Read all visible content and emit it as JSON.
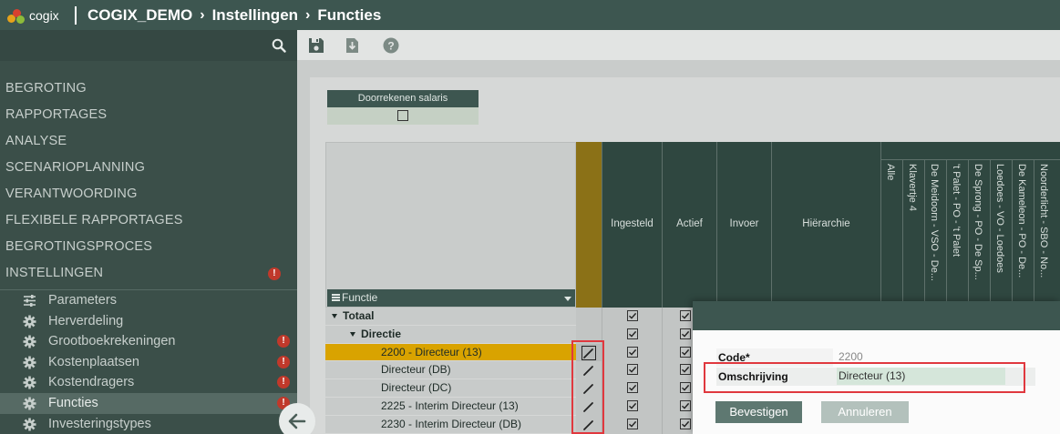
{
  "header": {
    "logo_text": "cogix",
    "crumbs": [
      "COGIX_DEMO",
      "Instellingen",
      "Functies"
    ],
    "crumb_separator": "›"
  },
  "sidebar": {
    "search_icon": "search-icon",
    "main_items": [
      {
        "label": "BEGROTING",
        "alert": false
      },
      {
        "label": "RAPPORTAGES",
        "alert": false
      },
      {
        "label": "ANALYSE",
        "alert": false
      },
      {
        "label": "SCENARIOPLANNING",
        "alert": false
      },
      {
        "label": "VERANTWOORDING",
        "alert": false
      },
      {
        "label": "FLEXIBELE RAPPORTAGES",
        "alert": false
      },
      {
        "label": "BEGROTINGSPROCES",
        "alert": false
      },
      {
        "label": "INSTELLINGEN",
        "alert": true
      }
    ],
    "sub_items": [
      {
        "label": "Parameters",
        "icon": "sliders-icon",
        "alert": false,
        "active": false
      },
      {
        "label": "Herverdeling",
        "icon": "gear-icon",
        "alert": false,
        "active": false
      },
      {
        "label": "Grootboekrekeningen",
        "icon": "gear-icon",
        "alert": true,
        "active": false
      },
      {
        "label": "Kostenplaatsen",
        "icon": "gear-icon",
        "alert": true,
        "active": false
      },
      {
        "label": "Kostendragers",
        "icon": "gear-icon",
        "alert": true,
        "active": false
      },
      {
        "label": "Functies",
        "icon": "gear-icon",
        "alert": true,
        "active": true
      },
      {
        "label": "Investeringstypes",
        "icon": "gear-icon",
        "alert": false,
        "active": false
      }
    ],
    "alert_glyph": "!"
  },
  "toolbar": {
    "icons": [
      "save-icon",
      "download-icon",
      "help-icon"
    ]
  },
  "recalc": {
    "label": "Doorrekenen salaris",
    "checked": false
  },
  "grid": {
    "first_column_label": "Functie",
    "columns": [
      "Ingesteld",
      "Actief",
      "Invoer",
      "Hiërarchie"
    ],
    "vertical_columns": [
      "Alle",
      "Klavertje 4",
      "De Meidoorn - VSO - De...",
      "'t Palet - PO - 't Palet",
      "De Sprong - PO - De Sp...",
      "Loedoes - VO - Loedoes",
      "De Kameleon - PO - De...",
      "Noorderlicht - SBO - No..."
    ],
    "rows": [
      {
        "label": "Totaal",
        "level": 0,
        "expandable": true,
        "selected": false,
        "editable": false
      },
      {
        "label": "Directie",
        "level": 1,
        "expandable": true,
        "selected": false,
        "editable": false
      },
      {
        "label": "2200 - Directeur (13)",
        "level": 2,
        "expandable": false,
        "selected": true,
        "editable": true
      },
      {
        "label": "Directeur (DB)",
        "level": 2,
        "expandable": false,
        "selected": false,
        "editable": true
      },
      {
        "label": "Directeur (DC)",
        "level": 2,
        "expandable": false,
        "selected": false,
        "editable": true
      },
      {
        "label": "2225 - Interim Directeur (13)",
        "level": 2,
        "expandable": false,
        "selected": false,
        "editable": true
      },
      {
        "label": "2230 - Interim Directeur (DB)",
        "level": 2,
        "expandable": false,
        "selected": false,
        "editable": true
      }
    ]
  },
  "dialog": {
    "code_label": "Code*",
    "code_value": "2200",
    "omschrijving_label": "Omschrijving",
    "omschrijving_value": "Directeur (13)",
    "confirm_label": "Bevestigen",
    "cancel_label": "Annuleren"
  },
  "colors": {
    "header_bg": "#3d5650",
    "sidebar_bg": "#3b4f49",
    "selected_row": "#d9a300",
    "highlight_border": "#e0383e",
    "alert": "#c0392b"
  }
}
